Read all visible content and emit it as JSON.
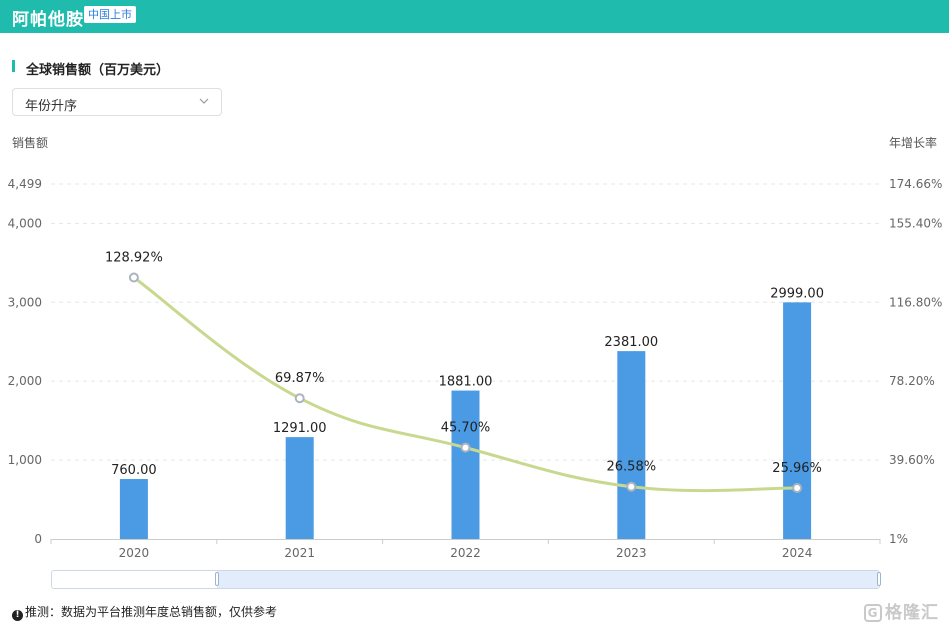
{
  "header": {
    "drug_name": "阿帕他胺",
    "market_badge": "中国上市"
  },
  "section": {
    "title": "全球销售额（百万美元）"
  },
  "sort_select": {
    "selected": "年份升序"
  },
  "footnote": {
    "text": "推测：数据为平台推测年度总销售额，仅供参考"
  },
  "watermark": {
    "logo_char": "G",
    "text": "格隆汇"
  },
  "colors": {
    "topbar": "#1fbcae",
    "bar": "#4a9be3",
    "line": "#c8d98f"
  },
  "chart_data": {
    "type": "bar",
    "categories": [
      "2020",
      "2021",
      "2022",
      "2023",
      "2024"
    ],
    "series": [
      {
        "type": "bar",
        "axis": "left",
        "values": [
          760.0,
          1291.0,
          1881.0,
          2381.0,
          2999.0
        ],
        "labels": [
          "760.00",
          "1291.00",
          "1881.00",
          "2381.00",
          "2999.00"
        ]
      },
      {
        "type": "line",
        "axis": "right",
        "values": [
          128.92,
          69.87,
          45.7,
          26.58,
          25.96
        ],
        "labels": [
          "128.92%",
          "69.87%",
          "45.70%",
          "26.58%",
          "25.96%"
        ]
      }
    ],
    "ylabel": "销售额",
    "y2label": "年增长率",
    "ylim": [
      0,
      4499
    ],
    "y2lim": [
      1,
      174.66
    ],
    "yticks": [
      "0",
      "1,000",
      "2,000",
      "3,000",
      "4,000",
      "4,499"
    ],
    "y2ticks": [
      "1%",
      "39.60%",
      "78.20%",
      "116.80%",
      "155.40%",
      "174.66%"
    ],
    "grid": true
  }
}
